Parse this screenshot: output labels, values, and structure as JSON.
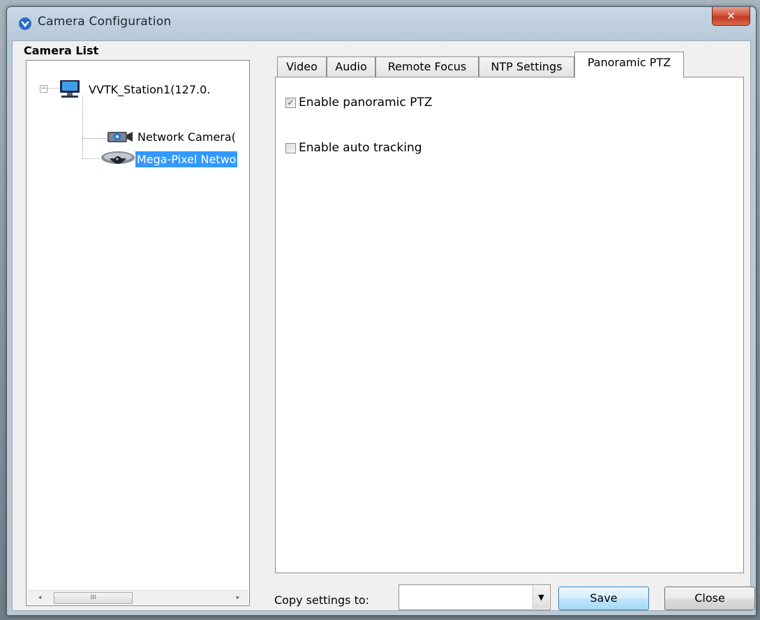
{
  "window": {
    "title": "Camera Configuration",
    "close_symbol": "✕"
  },
  "camera_list": {
    "title": "Camera List",
    "items": [
      {
        "label": "VVTK_Station1(127.0.",
        "icon": "computer-icon",
        "expanded": true
      },
      {
        "label": "Network Camera(",
        "icon": "box-camera-icon"
      },
      {
        "label": "Mega-Pixel Netwo",
        "icon": "dome-camera-icon",
        "selected": true
      }
    ],
    "expander_symbol": "−",
    "scroll_left": "◂",
    "scroll_right": "▸",
    "scroll_grip": "III"
  },
  "tabs": [
    {
      "label": "Video"
    },
    {
      "label": "Audio"
    },
    {
      "label": "Remote Focus"
    },
    {
      "label": "NTP Settings"
    },
    {
      "label": "Panoramic PTZ",
      "active": true
    }
  ],
  "panoramic_ptz": {
    "enable_panoramic": {
      "label": "Enable panoramic PTZ",
      "checked": true,
      "mark": "✓"
    },
    "enable_auto_tracking": {
      "label": "Enable auto tracking",
      "checked": false
    }
  },
  "footer": {
    "copy_label": "Copy settings to:",
    "copy_value": "",
    "combo_arrow": "▼",
    "save_label": "Save",
    "close_label": "Close"
  },
  "colors": {
    "selection": "#3399ff",
    "close_button": "#c13a20"
  }
}
